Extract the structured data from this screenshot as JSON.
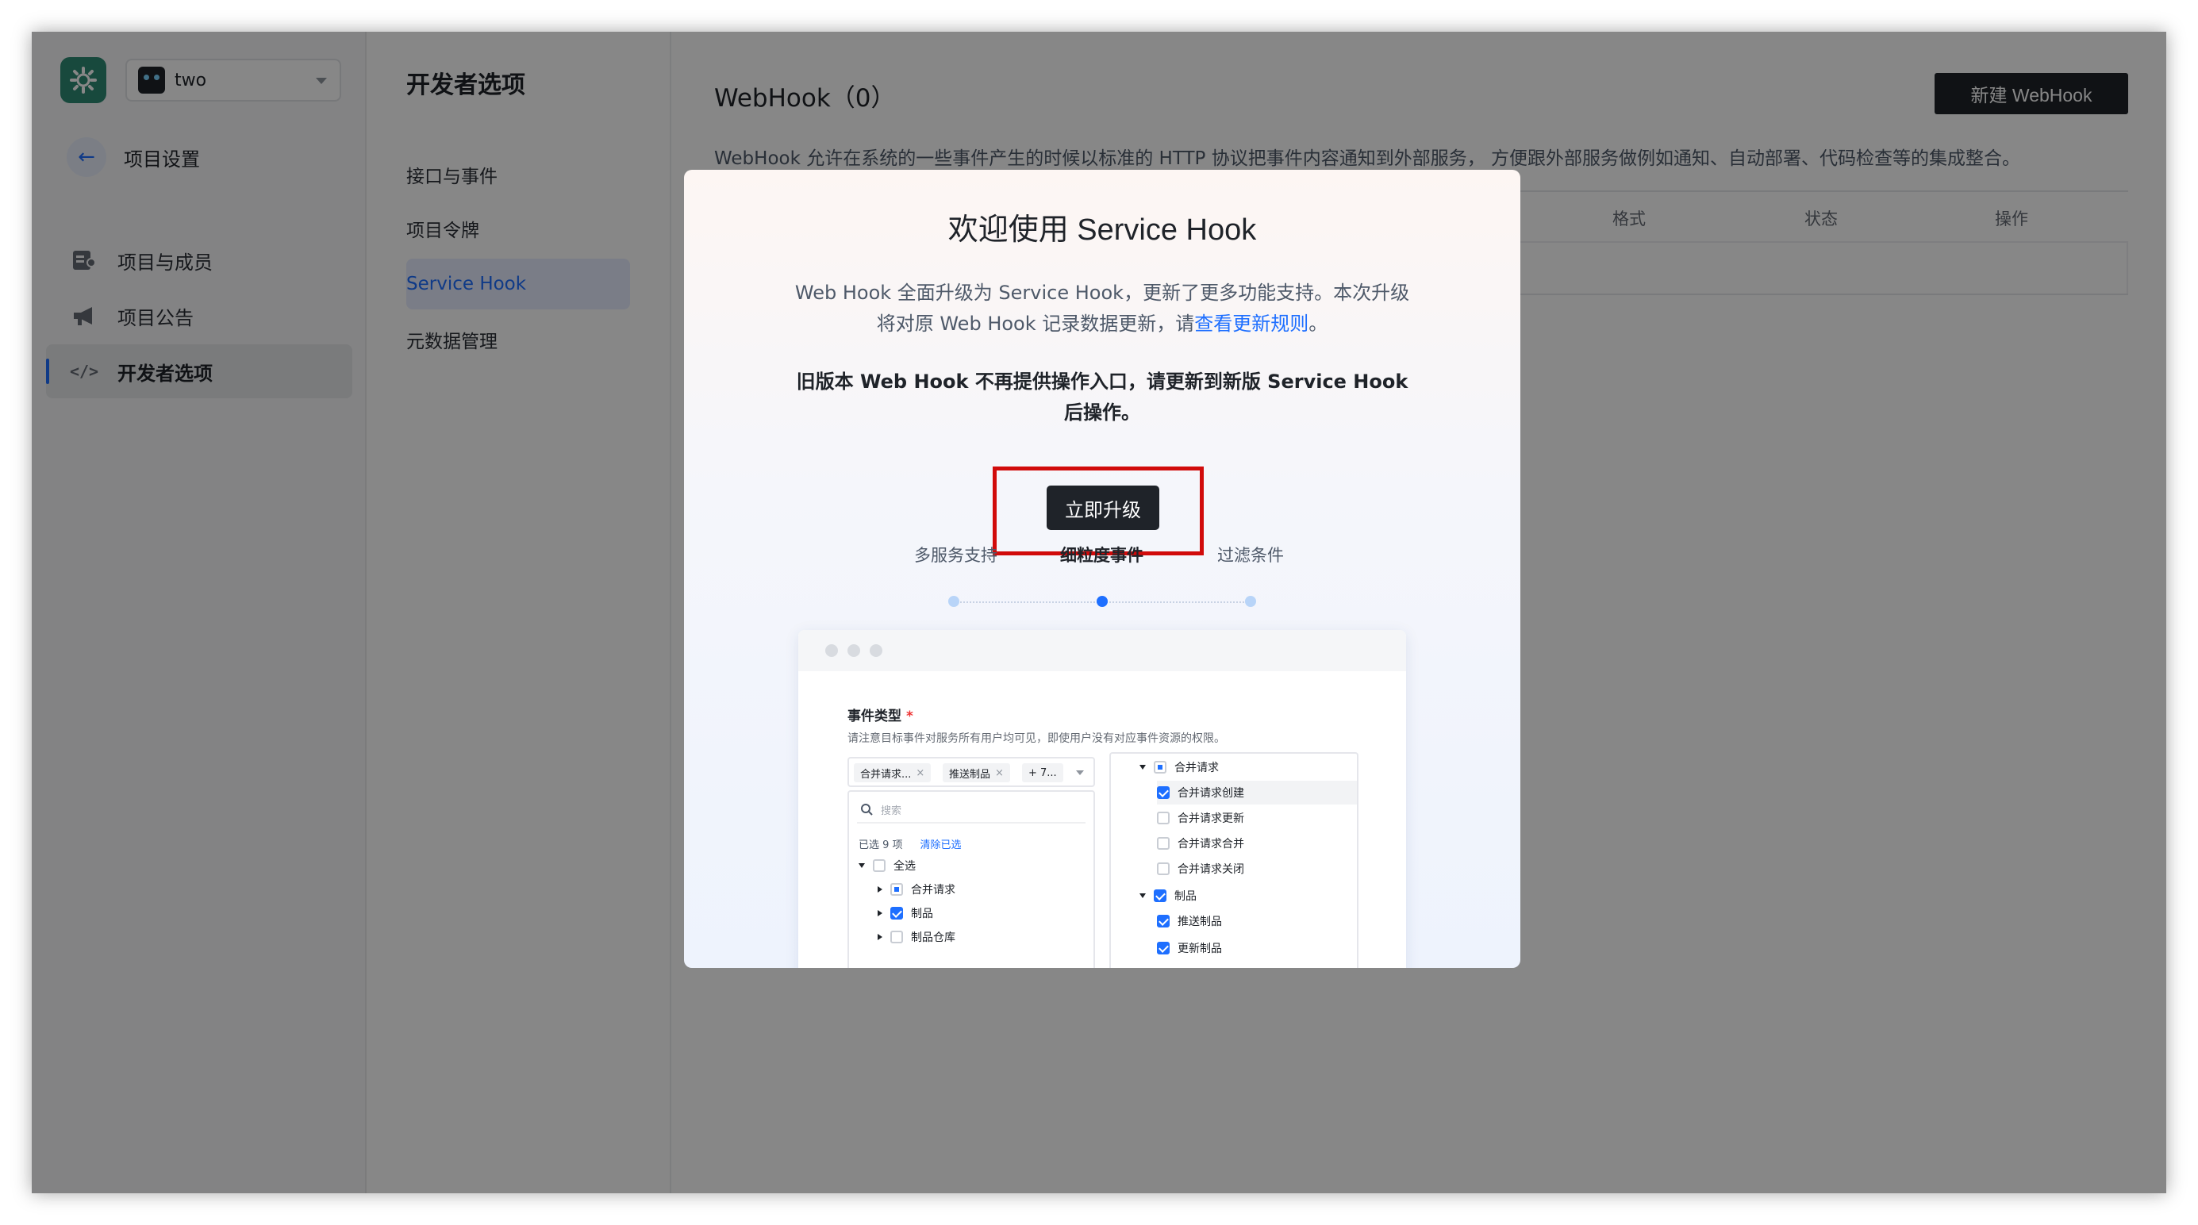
{
  "project": {
    "name": "two"
  },
  "sidebar": {
    "back_label": "项目设置",
    "items": [
      {
        "label": "项目与成员",
        "icon": "members-icon"
      },
      {
        "label": "项目公告",
        "icon": "megaphone-icon"
      },
      {
        "label": "开发者选项",
        "icon": "code-icon",
        "active": true
      }
    ]
  },
  "subnav": {
    "title": "开发者选项",
    "items": [
      {
        "label": "接口与事件"
      },
      {
        "label": "项目令牌"
      },
      {
        "label": "Service Hook",
        "active": true
      },
      {
        "label": "元数据管理"
      }
    ]
  },
  "main": {
    "title": "WebHook（0）",
    "new_button": "新建 WebHook",
    "description": "WebHook 允许在系统的一些事件产生的时候以标准的 HTTP 协议把事件内容通知到外部服务， 方便跟外部服务做例如通知、自动部署、代码检查等的集成整合。",
    "table_headers": [
      "格式",
      "状态",
      "操作"
    ]
  },
  "modal": {
    "title": "欢迎使用 Service Hook",
    "desc_part1": "Web Hook 全面升级为 Service Hook，更新了更多功能支持。本次升级将对原 Web Hook 记录数据更新，请",
    "desc_link": "查看更新规则",
    "desc_end": "。",
    "warning": "旧版本 Web Hook 不再提供操作入口，请更新到新版 Service Hook 后操作。",
    "upgrade_button": "立即升级",
    "tabs": [
      {
        "label": "多服务支持"
      },
      {
        "label": "细粒度事件",
        "active": true
      },
      {
        "label": "过滤条件"
      }
    ],
    "preview": {
      "label": "事件类型",
      "required_mark": "*",
      "hint": "请注意目标事件对服务所有用户均可见，即使用户没有对应事件资源的权限。",
      "tags": [
        "合并请求...",
        "推送制品",
        "+ 7..."
      ],
      "search_placeholder": "搜索",
      "selected_count": "已选 9 项",
      "clear_label": "清除已选",
      "left_tree": [
        {
          "label": "全选",
          "state": "unchecked",
          "arrow": "down"
        },
        {
          "label": "合并请求",
          "state": "partial",
          "arrow": "right"
        },
        {
          "label": "制品",
          "state": "checked",
          "arrow": "right"
        },
        {
          "label": "制品仓库",
          "state": "unchecked",
          "arrow": "right"
        }
      ],
      "right_tree": [
        {
          "label": "合并请求",
          "state": "partial",
          "arrow": "down"
        },
        {
          "label": "合并请求创建",
          "state": "checked"
        },
        {
          "label": "合并请求更新",
          "state": "unchecked"
        },
        {
          "label": "合并请求合并",
          "state": "unchecked"
        },
        {
          "label": "合并请求关闭",
          "state": "unchecked"
        },
        {
          "label": "制品",
          "state": "checked",
          "arrow": "down"
        },
        {
          "label": "推送制品",
          "state": "checked"
        },
        {
          "label": "更新制品",
          "state": "checked"
        }
      ]
    }
  },
  "colors": {
    "accent": "#1e6fff",
    "dark_button": "#1f2329",
    "highlight_box": "#d10b0b",
    "logo": "#2f8b74"
  }
}
